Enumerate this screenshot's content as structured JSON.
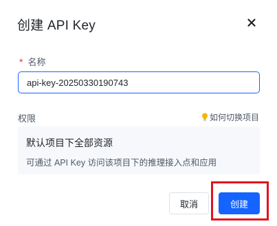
{
  "dialog": {
    "title": "创建 API Key",
    "close_icon": "close-icon"
  },
  "name_field": {
    "required_mark": "*",
    "label": "名称",
    "value": "api-key-20250330190743"
  },
  "permission": {
    "label": "权限",
    "switch_link": "如何切换项目",
    "switch_icon": "lightbulb-icon",
    "scope_title": "默认项目下全部资源",
    "scope_desc": "可通过 API Key 访问该项目下的推理接入点和应用"
  },
  "footer": {
    "cancel_label": "取消",
    "create_label": "创建"
  },
  "colors": {
    "primary": "#1664ff",
    "required": "#e8322e",
    "highlight": "#e3101f",
    "bulb": "#f7b500"
  }
}
